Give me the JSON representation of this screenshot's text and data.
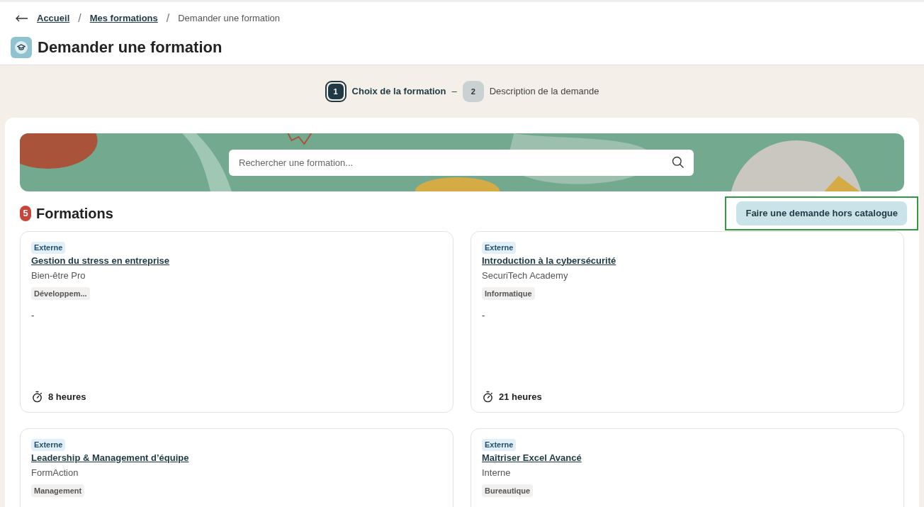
{
  "breadcrumb": [
    {
      "label": "Accueil",
      "link": true,
      "separator": "/"
    },
    {
      "label": "Mes formations",
      "link": true,
      "separator": "/"
    },
    {
      "label": "Demander une formation",
      "link": false
    }
  ],
  "step_separator": "–",
  "title": "Demander une formation",
  "steps": [
    {
      "number": "1",
      "label": "Choix de la formation",
      "selected": true
    },
    {
      "number": "2",
      "label": "Description de la demande",
      "selected": false
    }
  ],
  "search": {
    "placeholder": "Rechercher une formation..."
  },
  "section": {
    "count": "5",
    "title": "Formations",
    "button": "Faire une demande hors catalogue"
  },
  "courses": [
    {
      "tag": "Externe",
      "title": "Gestion du stress en entreprise",
      "provider": "Bien-être Pro",
      "category": "Développem...",
      "description": "-",
      "duration": "8 heures"
    },
    {
      "tag": "Externe",
      "title": "Introduction à la cybersécurité",
      "provider": "SecuriTech Academy",
      "category": "Informatique",
      "description": "-",
      "duration": "21 heures"
    },
    {
      "tag": "Externe",
      "title": "Leadership & Management d’équipe",
      "provider": "FormAction",
      "category": "Management"
    },
    {
      "tag": "Externe",
      "title": "Maîtriser Excel Avancé",
      "provider": "Interne",
      "category": "Bureautique"
    }
  ]
}
